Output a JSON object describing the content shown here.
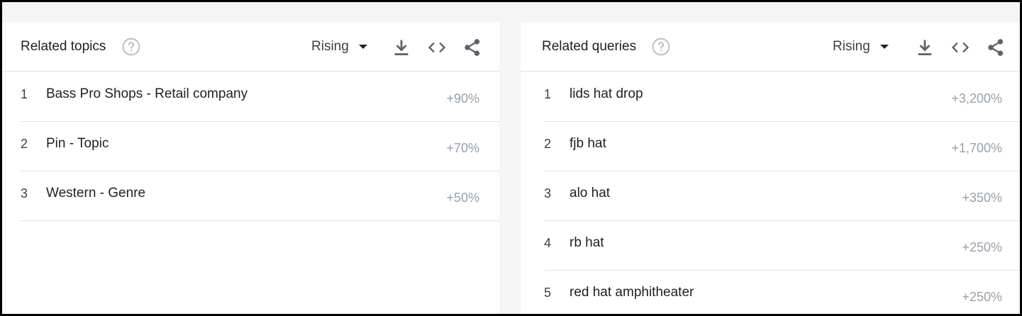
{
  "related_topics": {
    "title": "Related topics",
    "sort_label": "Rising",
    "items": [
      {
        "rank": "1",
        "name": "Bass Pro Shops - Retail company",
        "value": "+90%"
      },
      {
        "rank": "2",
        "name": "Pin - Topic",
        "value": "+70%"
      },
      {
        "rank": "3",
        "name": "Western - Genre",
        "value": "+50%"
      }
    ]
  },
  "related_queries": {
    "title": "Related queries",
    "sort_label": "Rising",
    "items": [
      {
        "rank": "1",
        "name": "lids hat drop",
        "value": "+3,200%"
      },
      {
        "rank": "2",
        "name": "fjb hat",
        "value": "+1,700%"
      },
      {
        "rank": "3",
        "name": "alo hat",
        "value": "+350%"
      },
      {
        "rank": "4",
        "name": "rb hat",
        "value": "+250%"
      },
      {
        "rank": "5",
        "name": "red hat amphitheater",
        "value": "+250%"
      }
    ]
  },
  "icons": {
    "help": "help-circle-icon",
    "download": "download-icon",
    "embed": "embed-code-icon",
    "share": "share-icon"
  },
  "colors": {
    "text_primary": "#202124",
    "text_secondary": "#3c4043",
    "value_gray": "#9aa0a6",
    "icon_gray": "#5f6368",
    "divider": "#e0e0e0",
    "background": "#f5f5f5"
  }
}
